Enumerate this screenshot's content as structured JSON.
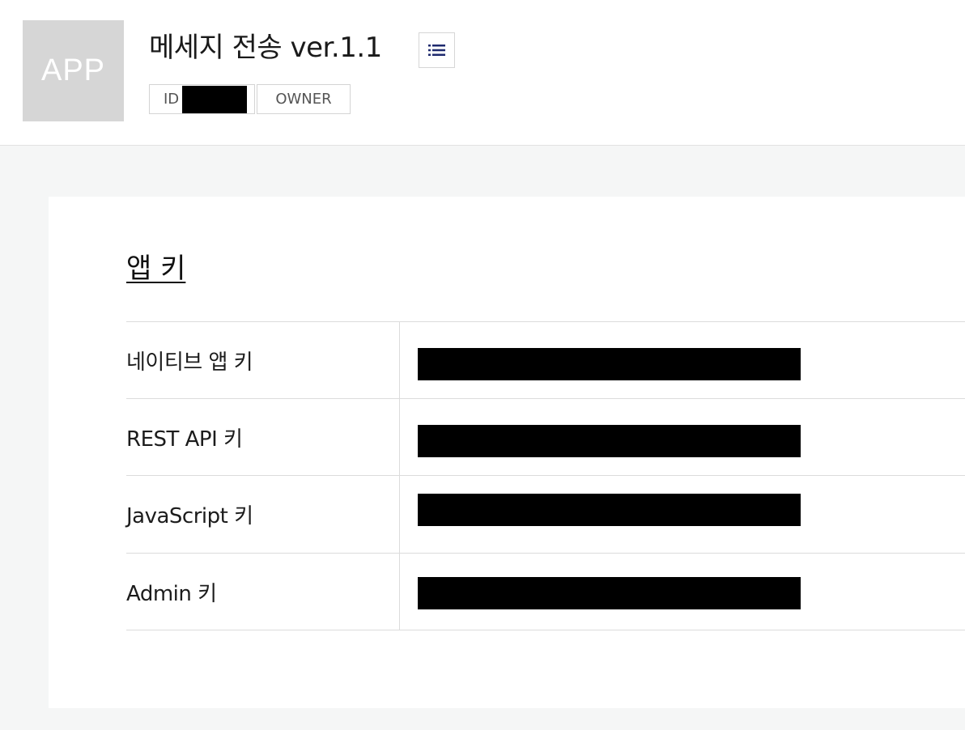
{
  "header": {
    "app_icon_text": "APP",
    "title": "메세지 전송 ver.1.1",
    "menu_icon": "list-icon",
    "tags": {
      "id_label": "ID",
      "owner_label": "OWNER"
    }
  },
  "section": {
    "title": "앱 키"
  },
  "keys": [
    {
      "label": "네이티브 앱 키"
    },
    {
      "label": "REST API 키"
    },
    {
      "label": "JavaScript 키"
    },
    {
      "label": "Admin 키"
    }
  ],
  "colors": {
    "page_background": "#f5f6f6",
    "card_background": "#ffffff",
    "app_icon_background": "#d6d6d6",
    "menu_icon": "#1e2a6e",
    "redaction": "#000000"
  }
}
